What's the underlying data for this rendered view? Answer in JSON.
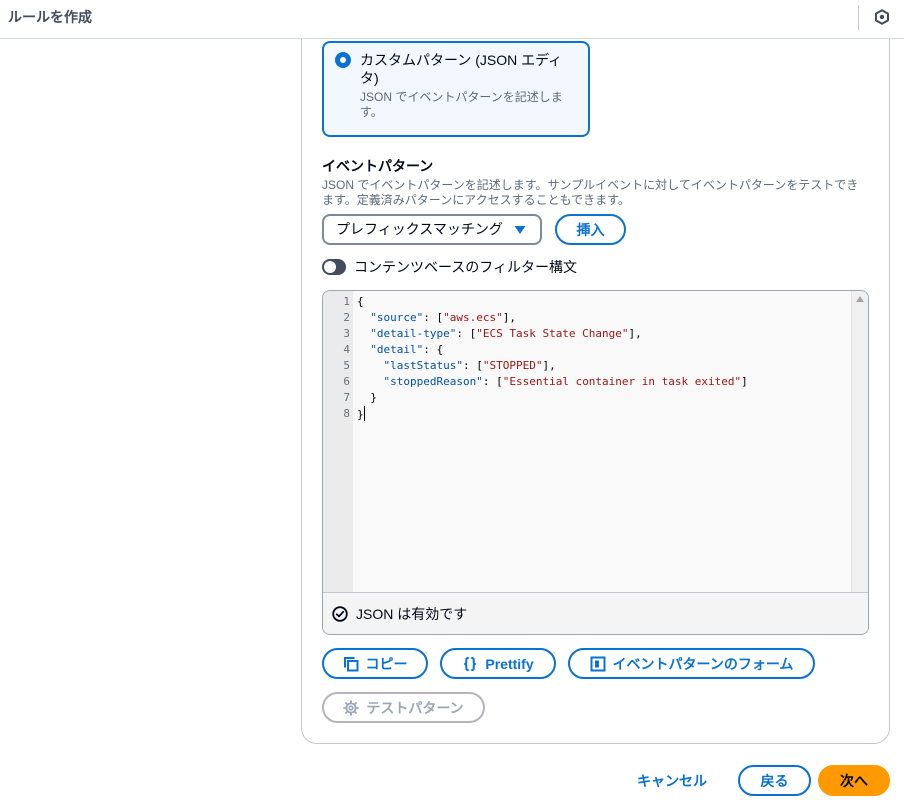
{
  "header": {
    "title": "ルールを作成",
    "panel_icon": "hexagon-panel-icon"
  },
  "pattern_method": {
    "option": {
      "label": "カスタムパターン (JSON エディタ)",
      "description": "JSON でイベントパターンを記述します。",
      "selected": true
    }
  },
  "event_pattern": {
    "heading": "イベントパターン",
    "description": "JSON でイベントパターンを記述します。サンプルイベントに対してイベントパターンをテストできます。定義済みパターンにアクセスすることもできます。",
    "matching_select": {
      "value": "プレフィックスマッチング",
      "icon": "caret-down-icon"
    },
    "insert_button": "挿入",
    "content_filter_toggle": {
      "label": "コンテンツベースのフィルター構文",
      "checked": false
    }
  },
  "editor": {
    "lines": [
      {
        "n": "1",
        "tokens": [
          [
            "p",
            "{"
          ]
        ]
      },
      {
        "n": "2",
        "tokens": [
          [
            "p",
            "  "
          ],
          [
            "k",
            "\"source\""
          ],
          [
            "p",
            ": ["
          ],
          [
            "s",
            "\"aws.ecs\""
          ],
          [
            "p",
            "],"
          ]
        ]
      },
      {
        "n": "3",
        "tokens": [
          [
            "p",
            "  "
          ],
          [
            "k",
            "\"detail-type\""
          ],
          [
            "p",
            ": ["
          ],
          [
            "s",
            "\"ECS Task State Change\""
          ],
          [
            "p",
            "],"
          ]
        ]
      },
      {
        "n": "4",
        "tokens": [
          [
            "p",
            "  "
          ],
          [
            "k",
            "\"detail\""
          ],
          [
            "p",
            ": {"
          ]
        ]
      },
      {
        "n": "5",
        "tokens": [
          [
            "p",
            "    "
          ],
          [
            "k",
            "\"lastStatus\""
          ],
          [
            "p",
            ": ["
          ],
          [
            "s",
            "\"STOPPED\""
          ],
          [
            "p",
            "],"
          ]
        ]
      },
      {
        "n": "6",
        "tokens": [
          [
            "p",
            "    "
          ],
          [
            "k",
            "\"stoppedReason\""
          ],
          [
            "p",
            ": ["
          ],
          [
            "s",
            "\"Essential container in task exited\""
          ],
          [
            "p",
            "]"
          ]
        ]
      },
      {
        "n": "7",
        "tokens": [
          [
            "p",
            "  }"
          ]
        ]
      },
      {
        "n": "8",
        "tokens": [
          [
            "p",
            "}"
          ]
        ]
      }
    ],
    "status": {
      "icon": "check-circle-icon",
      "text": "JSON は有効です"
    }
  },
  "editor_actions": {
    "copy": {
      "label": "コピー",
      "icon": "copy-icon"
    },
    "prettify": {
      "label": "Prettify",
      "icon": "curly-braces-icon"
    },
    "form_view": {
      "label": "イベントパターンのフォーム",
      "icon": "form-view-icon"
    },
    "test_pattern": {
      "label": "テストパターン",
      "icon": "gear-icon",
      "disabled": true
    }
  },
  "footer": {
    "cancel": "キャンセル",
    "back": "戻る",
    "next": "次へ"
  },
  "colors": {
    "accent": "#0972d3",
    "primary_button": "#ff9900",
    "text": "#000716",
    "secondary_text": "#5f6b7a",
    "disabled": "#9ba7b6",
    "code_key": "#0451a5",
    "code_string": "#a31515"
  }
}
